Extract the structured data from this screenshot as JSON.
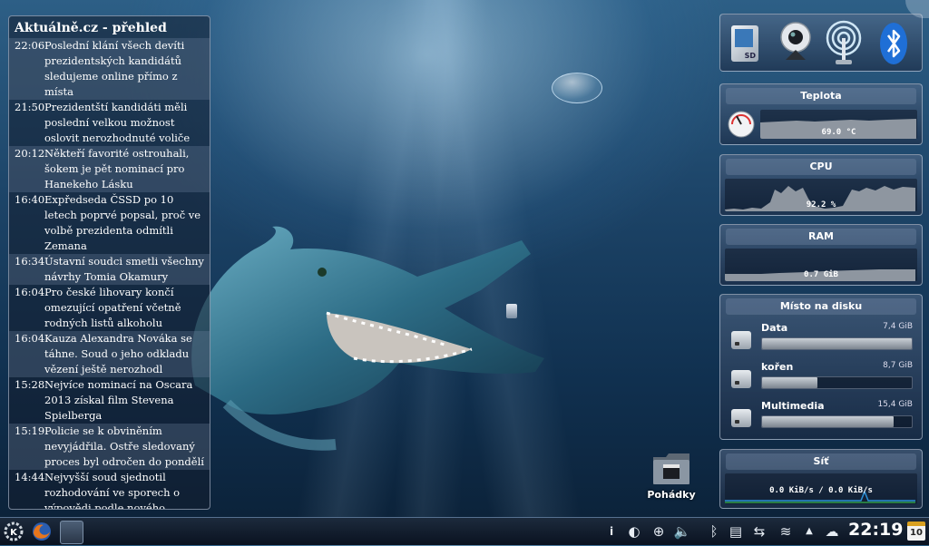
{
  "news": {
    "title": "Aktuálně.cz - přehled",
    "items": [
      {
        "time": "22:06",
        "text": "Poslední klání všech devíti prezidentských kandidátů sledujeme online přímo z místa"
      },
      {
        "time": "21:50",
        "text": "Prezidentští kandidáti měli poslední velkou možnost oslovit nerozhodnuté voliče"
      },
      {
        "time": "20:12",
        "text": "Někteří favorité ostrouhali, šokem je pět nominací pro Hanekeho Lásku"
      },
      {
        "time": "16:40",
        "text": "Expředseda ČSSD po 10 letech poprvé popsal, proč ve volbě prezidenta odmítli Zemana"
      },
      {
        "time": "16:34",
        "text": "Ústavní soudci smetli všechny návrhy Tomia Okamury"
      },
      {
        "time": "16:04",
        "text": "Pro české lihovary končí omezující opatření včetně rodných listů alkoholu"
      },
      {
        "time": "16:04",
        "text": "Kauza Alexandra Nováka se táhne. Soud o jeho odkladu vězení ještě nerozhodl"
      },
      {
        "time": "15:28",
        "text": "Nejvíce nominací na Oscara 2013 získal film Stevena Spielberga"
      },
      {
        "time": "15:19",
        "text": "Policie se k obviněním nevyjádřila. Ostře sledovaný proces byl odročen do pondělí"
      },
      {
        "time": "14:44",
        "text": "Nejvyšší soud sjednotil rozhodování ve sporech o výpovědi podle nového"
      }
    ]
  },
  "devices": {
    "icons": [
      "sd-card-icon",
      "webcam-icon",
      "wifi-antenna-icon",
      "bluetooth-icon"
    ],
    "sd_label": "SD"
  },
  "teplota": {
    "title": "Teplota",
    "value": "69.0 °C"
  },
  "cpu": {
    "title": "CPU",
    "value": "92.2 %"
  },
  "ram": {
    "title": "RAM",
    "value": "0.7 GiB"
  },
  "disk": {
    "title": "Místo na disku",
    "items": [
      {
        "name": "Data",
        "size": "7,4 GiB",
        "fill": 1.0
      },
      {
        "name": "kořen",
        "size": "8,7 GiB",
        "fill": 0.37
      },
      {
        "name": "Multimedia",
        "size": "15,4 GiB",
        "fill": 0.88
      }
    ]
  },
  "sit": {
    "title": "Síť",
    "value": "0.0 KiB/s / 0.0 KiB/s"
  },
  "desktop": {
    "folder_label": "Pohádky"
  },
  "taskbar": {
    "clock": "22:19",
    "calendar_day": "10"
  },
  "colors": {
    "accent": "#1e5a8a",
    "graph": "#8e96a0",
    "network_line": "#2b8fd6"
  }
}
